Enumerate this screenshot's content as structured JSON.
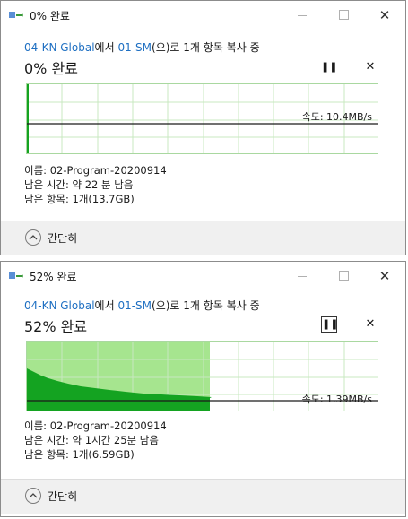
{
  "colors": {
    "link": "#1e6fc2",
    "graph_fill_light": "#a6e58f",
    "graph_fill_dark": "#14a321",
    "graph_grid": "#c8e8c0",
    "speed_line": "#1a1a1a"
  },
  "dialogs": [
    {
      "title": "0% 완료",
      "source": "04-KN Global",
      "from_suffix": "에서 ",
      "dest": "01-SM",
      "tail": "(으)로 1개 항목 복사 중",
      "status": "0% 완료",
      "pause_icon": "pause-icon",
      "stop_icon": "close-icon",
      "speed": "속도: 10.4MB/s",
      "progress": 0.0,
      "name_line": "이름: 02-Program-20200914",
      "time_line": "남은 시간: 약 22 분 남음",
      "items_line": "남은 항목: 1개(13.7GB)",
      "collapse_label": "간단히"
    },
    {
      "title": "52% 완료",
      "source": "04-KN Global",
      "from_suffix": "에서 ",
      "dest": "01-SM",
      "tail": "(으)로 1개 항목 복사 중",
      "status": "52% 완료",
      "pause_icon": "pause-icon",
      "stop_icon": "close-icon",
      "speed": "속도: 1.39MB/s",
      "progress": 0.52,
      "name_line": "이름: 02-Program-20200914",
      "time_line": "남은 시간: 약 1시간 25분 남음",
      "items_line": "남은 항목: 1개(6.59GB)",
      "collapse_label": "간단히"
    }
  ]
}
